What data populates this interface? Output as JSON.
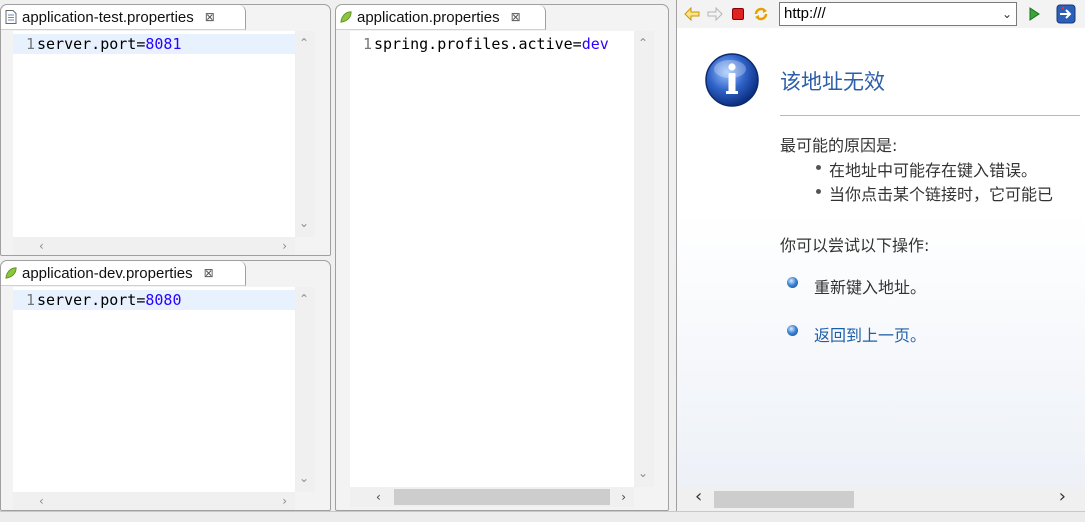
{
  "editors": {
    "test": {
      "tab_label": "application-test.properties",
      "line_number": "1",
      "key": "server.port=",
      "value": "8081"
    },
    "dev": {
      "tab_label": "application-dev.properties",
      "line_number": "1",
      "key": "server.port=",
      "value": "8080"
    },
    "main": {
      "tab_label": "application.properties",
      "line_number": "1",
      "key": "spring.profiles.active=",
      "value": "dev"
    },
    "close_glyph": "⊠"
  },
  "browser": {
    "url": "http:///",
    "error": {
      "title": "该地址无效",
      "reasons_heading": "最可能的原因是:",
      "reasons": [
        "在地址中可能存在键入错误。",
        "当你点击某个链接时，它可能已"
      ],
      "actions_heading": "你可以尝试以下操作:",
      "actions": [
        "重新键入地址。",
        "返回到上一页。"
      ]
    }
  },
  "icons": {
    "back": "back-arrow-icon",
    "forward": "forward-arrow-icon",
    "stop": "stop-icon",
    "refresh": "refresh-icon",
    "go": "go-icon",
    "open_external": "external-browser-icon",
    "info": "info-icon"
  },
  "colors": {
    "value_blue": "#2a00ff",
    "link_blue": "#1f5fa8",
    "title_blue": "#2d5fa8",
    "leaf_green": "#7cb518"
  }
}
